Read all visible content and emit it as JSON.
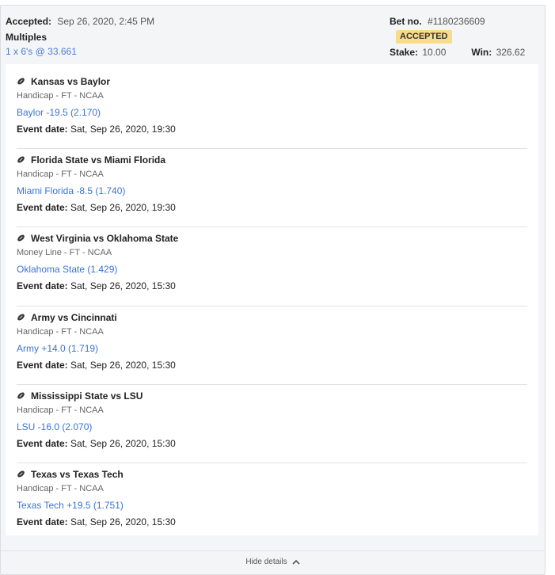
{
  "header": {
    "accepted_label": "Accepted:",
    "accepted_date": "Sep 26, 2020, 2:45 PM",
    "type": "Multiples",
    "combo": "1 x 6's",
    "odds": "@ 33.661",
    "bet_no_label": "Bet no.",
    "bet_no": "#1180236609",
    "status": "ACCEPTED",
    "stake_label": "Stake:",
    "stake": "10.00",
    "win_label": "Win:",
    "win": "326.62"
  },
  "legs": [
    {
      "match": "Kansas vs Baylor",
      "market": "Handicap - FT - NCAA",
      "selection": "Baylor -19.5 (2.170)",
      "event_label": "Event date:",
      "event_date": "Sat, Sep 26, 2020, 19:30"
    },
    {
      "match": "Florida State vs Miami Florida",
      "market": "Handicap - FT - NCAA",
      "selection": "Miami Florida -8.5 (1.740)",
      "event_label": "Event date:",
      "event_date": "Sat, Sep 26, 2020, 19:30"
    },
    {
      "match": "West Virginia vs Oklahoma State",
      "market": "Money Line - FT - NCAA",
      "selection": "Oklahoma State (1.429)",
      "event_label": "Event date:",
      "event_date": "Sat, Sep 26, 2020, 15:30"
    },
    {
      "match": "Army vs Cincinnati",
      "market": "Handicap - FT - NCAA",
      "selection": "Army +14.0 (1.719)",
      "event_label": "Event date:",
      "event_date": "Sat, Sep 26, 2020, 15:30"
    },
    {
      "match": "Mississippi State vs LSU",
      "market": "Handicap - FT - NCAA",
      "selection": "LSU -16.0 (2.070)",
      "event_label": "Event date:",
      "event_date": "Sat, Sep 26, 2020, 15:30"
    },
    {
      "match": "Texas vs Texas Tech",
      "market": "Handicap - FT - NCAA",
      "selection": "Texas Tech +19.5 (1.751)",
      "event_label": "Event date:",
      "event_date": "Sat, Sep 26, 2020, 15:30"
    }
  ],
  "footer": {
    "hide_label": "Hide details"
  },
  "icons": {
    "sport": "american-football-icon",
    "toggle": "chevron-up-icon"
  }
}
